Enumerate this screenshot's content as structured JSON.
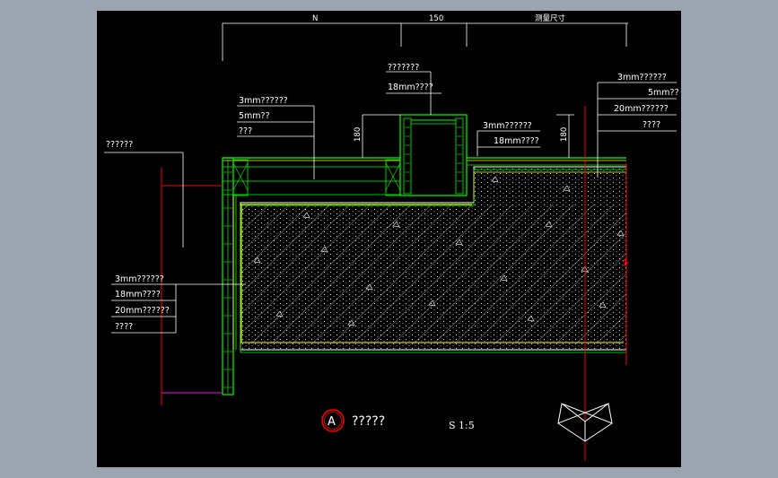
{
  "drawing": {
    "dimensions": {
      "left": "N",
      "middle": "150",
      "right": "测量尺寸",
      "vertical_left": "180",
      "vertical_right": "180"
    },
    "callouts": {
      "top_center": [
        "???????",
        "18mm????"
      ],
      "inner_center": [
        "3mm??????",
        "18mm????"
      ],
      "upper_left": [
        "3mm??????",
        "5mm??",
        "???"
      ],
      "far_left": "??????",
      "lower_left": [
        "3mm??????",
        "18mm????",
        "20mm??????",
        "????"
      ],
      "right": [
        "3mm??????",
        "5mm??",
        "20mm??????",
        "????"
      ]
    },
    "section_mark": "A",
    "title": "?????",
    "scale": "S 1:5"
  },
  "colors": {
    "background": "#000000",
    "frame": "#9aa5b1",
    "finish_green": "#00ff00",
    "screed_yellow": "#ffff00",
    "axis_red": "#ff0000",
    "leader_white": "#ffffff",
    "hatch_grey": "#bdbdbd"
  }
}
